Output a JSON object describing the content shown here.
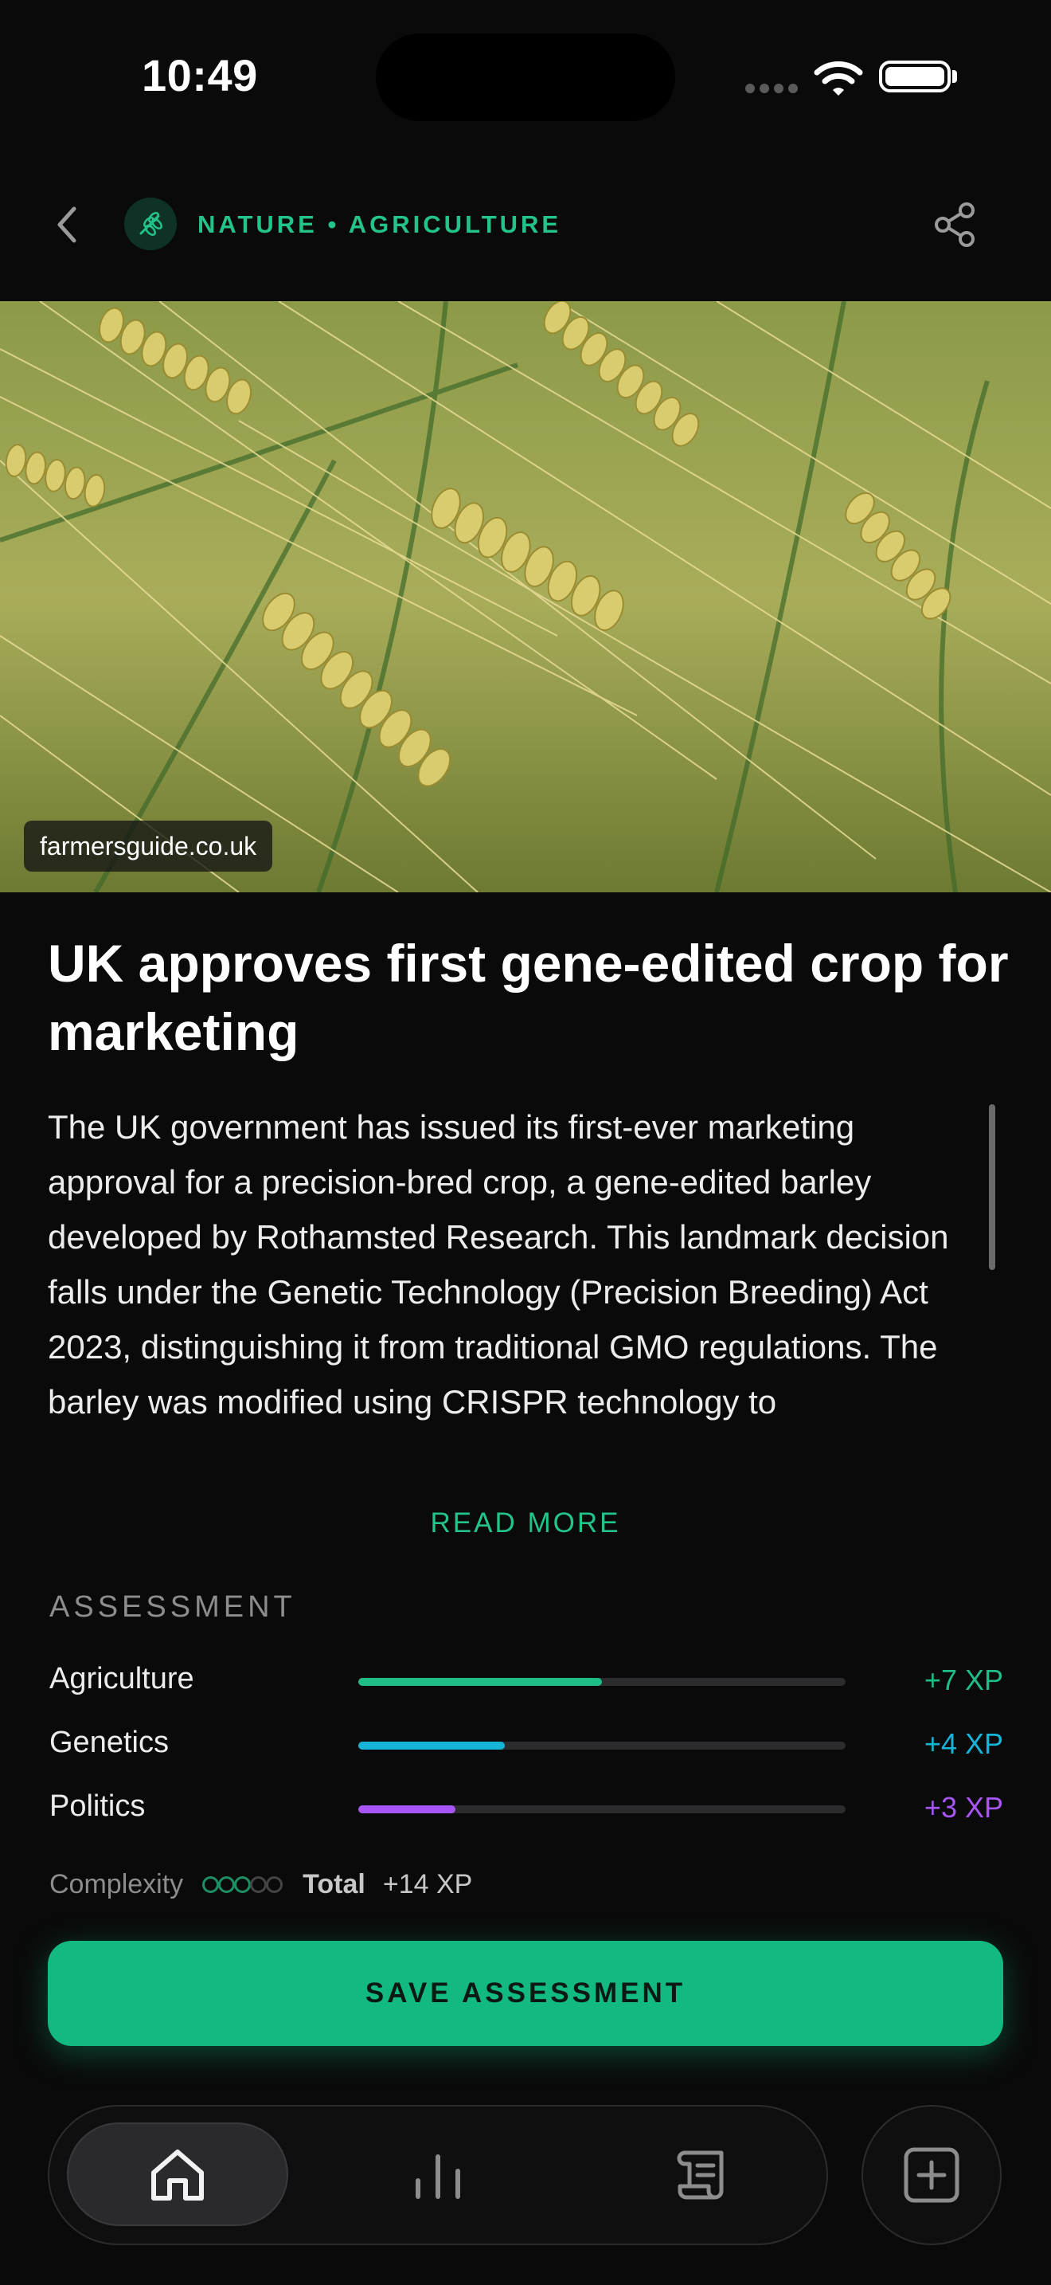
{
  "status_bar": {
    "time": "10:49"
  },
  "nav": {
    "category_label": "NATURE • AGRICULTURE",
    "category_icon": "wheat-icon",
    "back_icon": "chevron-left-icon",
    "share_icon": "share-icon"
  },
  "hero": {
    "source": "farmersguide.co.uk"
  },
  "article": {
    "headline": "UK approves first gene-edited crop for marketing",
    "body": "The UK government has issued its first-ever marketing approval for a precision-bred crop, a gene-edited barley developed by Rothamsted Research. This landmark decision falls under the Genetic Technology (Precision Breeding) Act 2023, distinguishing it from traditional GMO regulations. The barley was modified using CRISPR technology to",
    "read_more": "READ MORE"
  },
  "assessment": {
    "title": "ASSESSMENT",
    "metrics": [
      {
        "label": "Agriculture",
        "xp": "+7 XP",
        "level": 0.5,
        "color": "#1fbd86"
      },
      {
        "label": "Genetics",
        "xp": "+4 XP",
        "level": 0.3,
        "color": "#16b4d6"
      },
      {
        "label": "Politics",
        "xp": "+3 XP",
        "level": 0.2,
        "color": "#a855f7"
      }
    ],
    "complexity_label": "Complexity",
    "complexity_level": 3,
    "complexity_max": 5,
    "total_label": "Total",
    "total_value": "+14 XP"
  },
  "save_button": "SAVE ASSESSMENT",
  "tabbar": {
    "tabs": [
      {
        "icon": "home-icon",
        "active": true
      },
      {
        "icon": "chart-bars-icon",
        "active": false
      },
      {
        "icon": "scroll-icon",
        "active": false
      }
    ],
    "add_icon": "plus-square-icon"
  },
  "colors": {
    "accent": "#12b981",
    "background": "#0a0a0a"
  }
}
